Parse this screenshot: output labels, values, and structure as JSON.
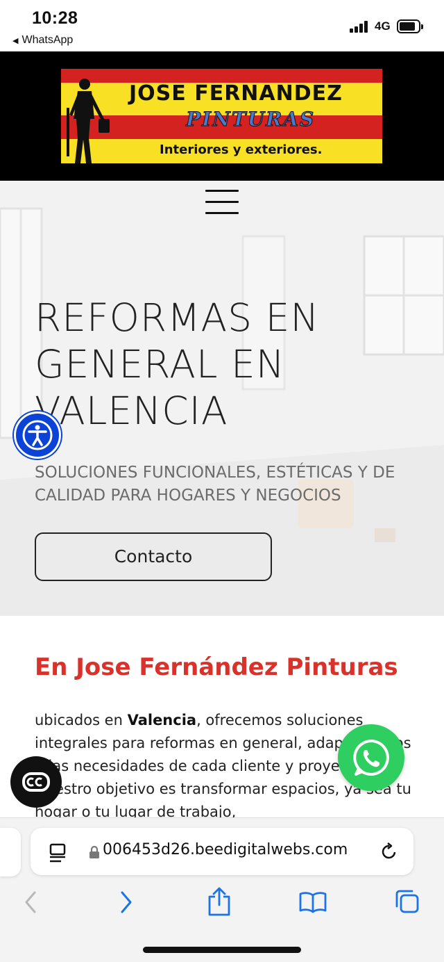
{
  "status_bar": {
    "time": "10:28",
    "back_app": "WhatsApp",
    "network": "4G"
  },
  "logo": {
    "title": "JOSE  FERNANDEZ",
    "script": "PINTURAS",
    "subtitle": "Interiores y exteriores."
  },
  "hero": {
    "title": "REFORMAS EN GENERAL EN VALENCIA",
    "subtitle": "SOLUCIONES FUNCIONALES, ESTÉTICAS Y DE CALIDAD PARA HOGARES Y NEGOCIOS",
    "contact_label": "Contacto"
  },
  "about": {
    "title": "En Jose Fernández Pinturas",
    "text_before": "ubicados en ",
    "text_bold": "Valencia",
    "text_after": ", ofrecemos soluciones integrales para reformas en general, adaptándonos a las necesidades de cada cliente y proyecto. Nuestro objetivo es transformar espacios, ya sea tu hogar o tu lugar de trabajo,"
  },
  "browser": {
    "url": "006453d26.beedigitalwebs.com"
  },
  "colors": {
    "accent_red": "#d9322a",
    "whatsapp_green": "#2fce61",
    "a11y_blue": "#0a43d6",
    "ios_blue": "#1a73e8"
  },
  "icons": {
    "menu": "hamburger-icon",
    "accessibility": "accessibility-icon",
    "whatsapp": "whatsapp-icon",
    "captions": "captions-icon",
    "reader": "reader-icon",
    "lock": "lock-icon",
    "reload": "reload-icon",
    "back": "chevron-left-icon",
    "forward": "chevron-right-icon",
    "share": "share-icon",
    "bookmarks": "book-icon",
    "tabs": "tabs-icon"
  }
}
